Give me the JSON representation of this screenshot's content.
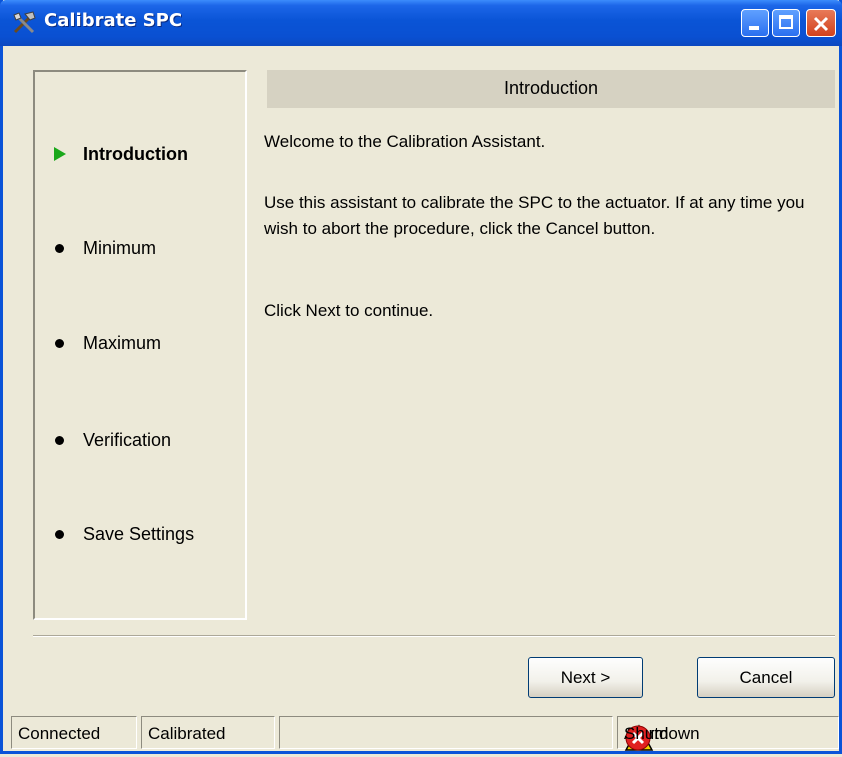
{
  "window": {
    "title": "Calibrate SPC",
    "icon": "tools-icon",
    "controls": [
      "minimize",
      "maximize",
      "close"
    ]
  },
  "steps": [
    {
      "label": "Introduction",
      "current": true,
      "marker": "play-arrow-icon"
    },
    {
      "label": "Minimum",
      "current": false,
      "marker": "bullet-icon"
    },
    {
      "label": "Maximum",
      "current": false,
      "marker": "bullet-icon"
    },
    {
      "label": "Verification",
      "current": false,
      "marker": "bullet-icon"
    },
    {
      "label": "Save Settings",
      "current": false,
      "marker": "bullet-icon"
    }
  ],
  "content": {
    "heading": "Introduction",
    "welcome": "Welcome to the Calibration Assistant.",
    "instructions": "Use this assistant to calibrate the SPC to the actuator.  If at any time you wish to abort the procedure, click the Cancel button.",
    "continue": "Click Next to continue."
  },
  "buttons": {
    "next": "Next >",
    "cancel": "Cancel"
  },
  "status": {
    "connected": "Connected",
    "calibrated": "Calibrated",
    "message": "",
    "alarm": "Alarm",
    "shutdown": "Shutdown"
  },
  "colors": {
    "titlebar": "#0a54d6",
    "current_step_arrow": "#1aa81a",
    "alarm": "#f5d000",
    "shutdown": "#e02020"
  }
}
